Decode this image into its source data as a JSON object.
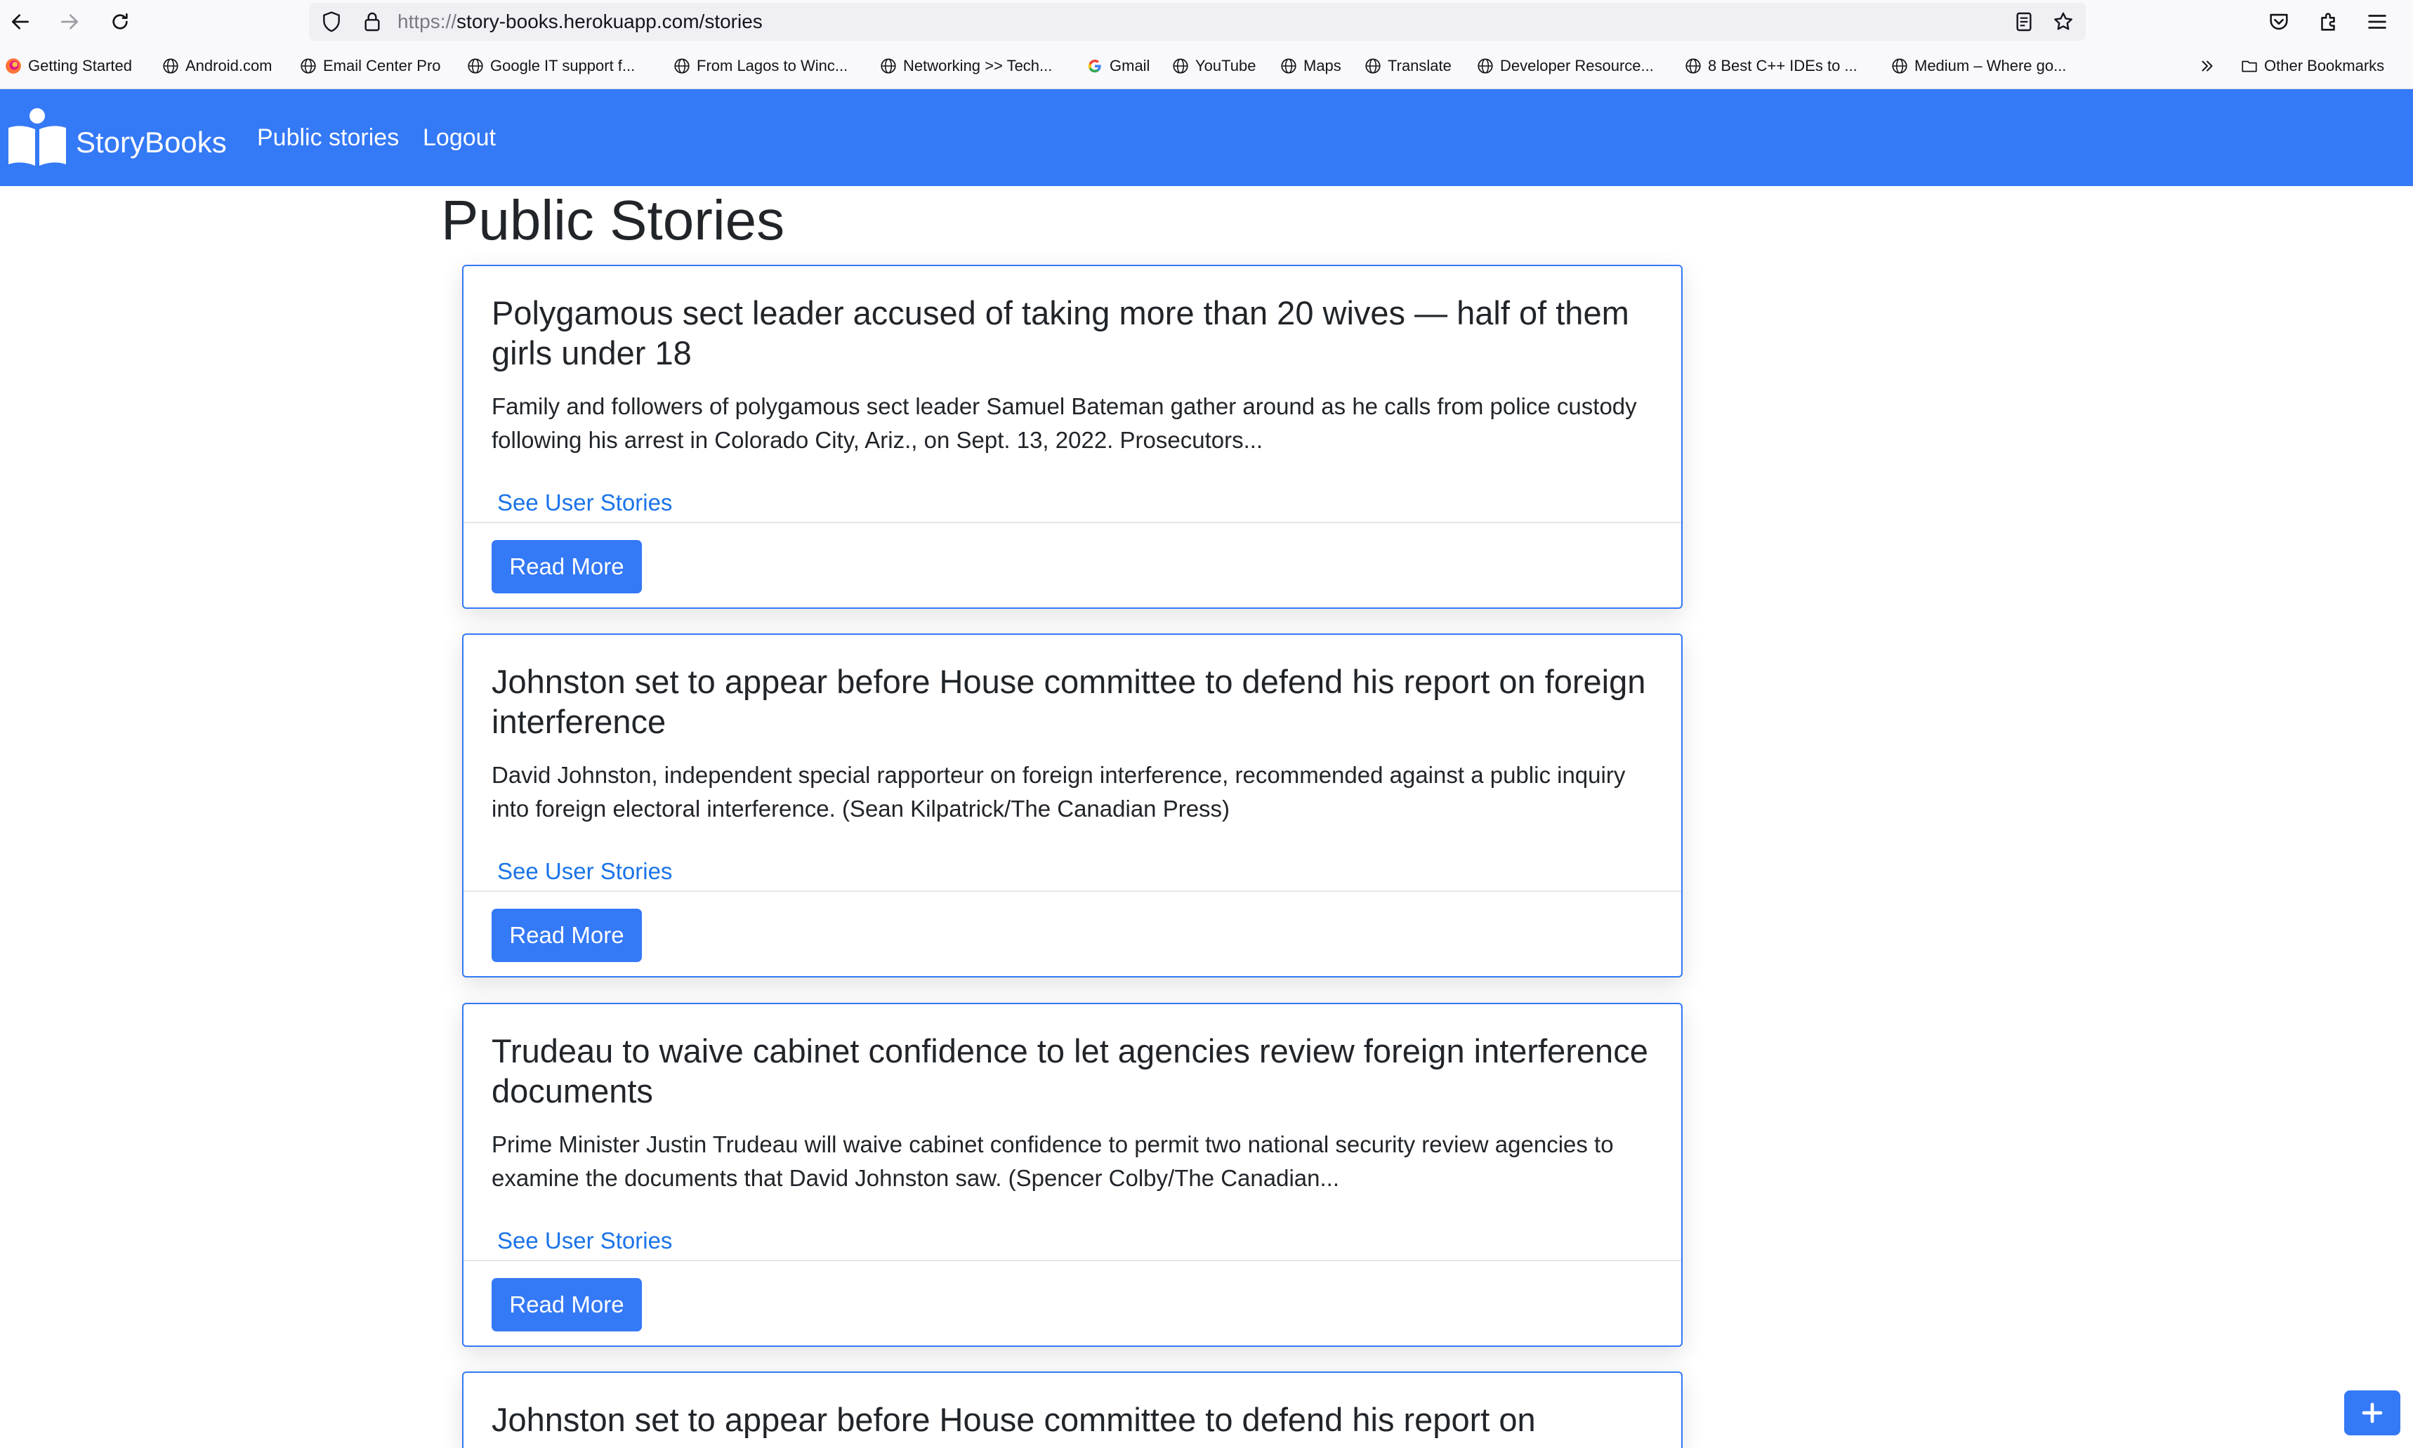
{
  "browser": {
    "url_scheme": "https://",
    "url_rest": "story-books.herokuapp.com/stories",
    "bookmarks": [
      {
        "label": "Getting Started",
        "icon": "firefox-icon"
      },
      {
        "label": "Android.com",
        "icon": "globe-icon"
      },
      {
        "label": "Email Center Pro",
        "icon": "globe-icon"
      },
      {
        "label": "Google IT support f...",
        "icon": "globe-icon"
      },
      {
        "label": "From Lagos to Winc...",
        "icon": "globe-icon"
      },
      {
        "label": "Networking >> Tech...",
        "icon": "globe-icon"
      },
      {
        "label": "Gmail",
        "icon": "google-icon"
      },
      {
        "label": "YouTube",
        "icon": "globe-icon"
      },
      {
        "label": "Maps",
        "icon": "globe-icon"
      },
      {
        "label": "Translate",
        "icon": "globe-icon"
      },
      {
        "label": "Developer Resource...",
        "icon": "globe-icon"
      },
      {
        "label": "8 Best C++ IDEs to ...",
        "icon": "globe-icon"
      },
      {
        "label": "Medium – Where go...",
        "icon": "globe-icon"
      }
    ],
    "other_bookmarks": "Other Bookmarks"
  },
  "navbar": {
    "brand": "StoryBooks",
    "links": [
      "Public stories",
      "Logout"
    ],
    "color": "#3479f6"
  },
  "page": {
    "title": "Public Stories"
  },
  "stories": [
    {
      "title": "Polygamous sect leader accused of taking more than 20 wives — half of them girls under 18",
      "excerpt": "Family and followers of polygamous sect leader Samuel Bateman gather around as he calls from police custody following his arrest in Colorado City, Ariz., on Sept. 13, 2022. Prosecutors...",
      "link": "See User Stories",
      "button": "Read More"
    },
    {
      "title": "Johnston set to appear before House committee to defend his report on foreign interference",
      "excerpt": "David Johnston, independent special rapporteur on foreign interference, recommended against a public inquiry into foreign electoral interference. (Sean Kilpatrick/The Canadian Press)",
      "link": "See User Stories",
      "button": "Read More"
    },
    {
      "title": "Trudeau to waive cabinet confidence to let agencies review foreign interference documents",
      "excerpt": "Prime Minister Justin Trudeau will waive cabinet confidence to permit two national security review agencies to examine the documents that David Johnston saw. (Spencer Colby/The Canadian...",
      "link": "See User Stories",
      "button": "Read More"
    },
    {
      "title": "Johnston set to appear before House committee to defend his report on",
      "excerpt": "",
      "link": "",
      "button": ""
    }
  ],
  "fab": {
    "icon": "plus-icon"
  }
}
